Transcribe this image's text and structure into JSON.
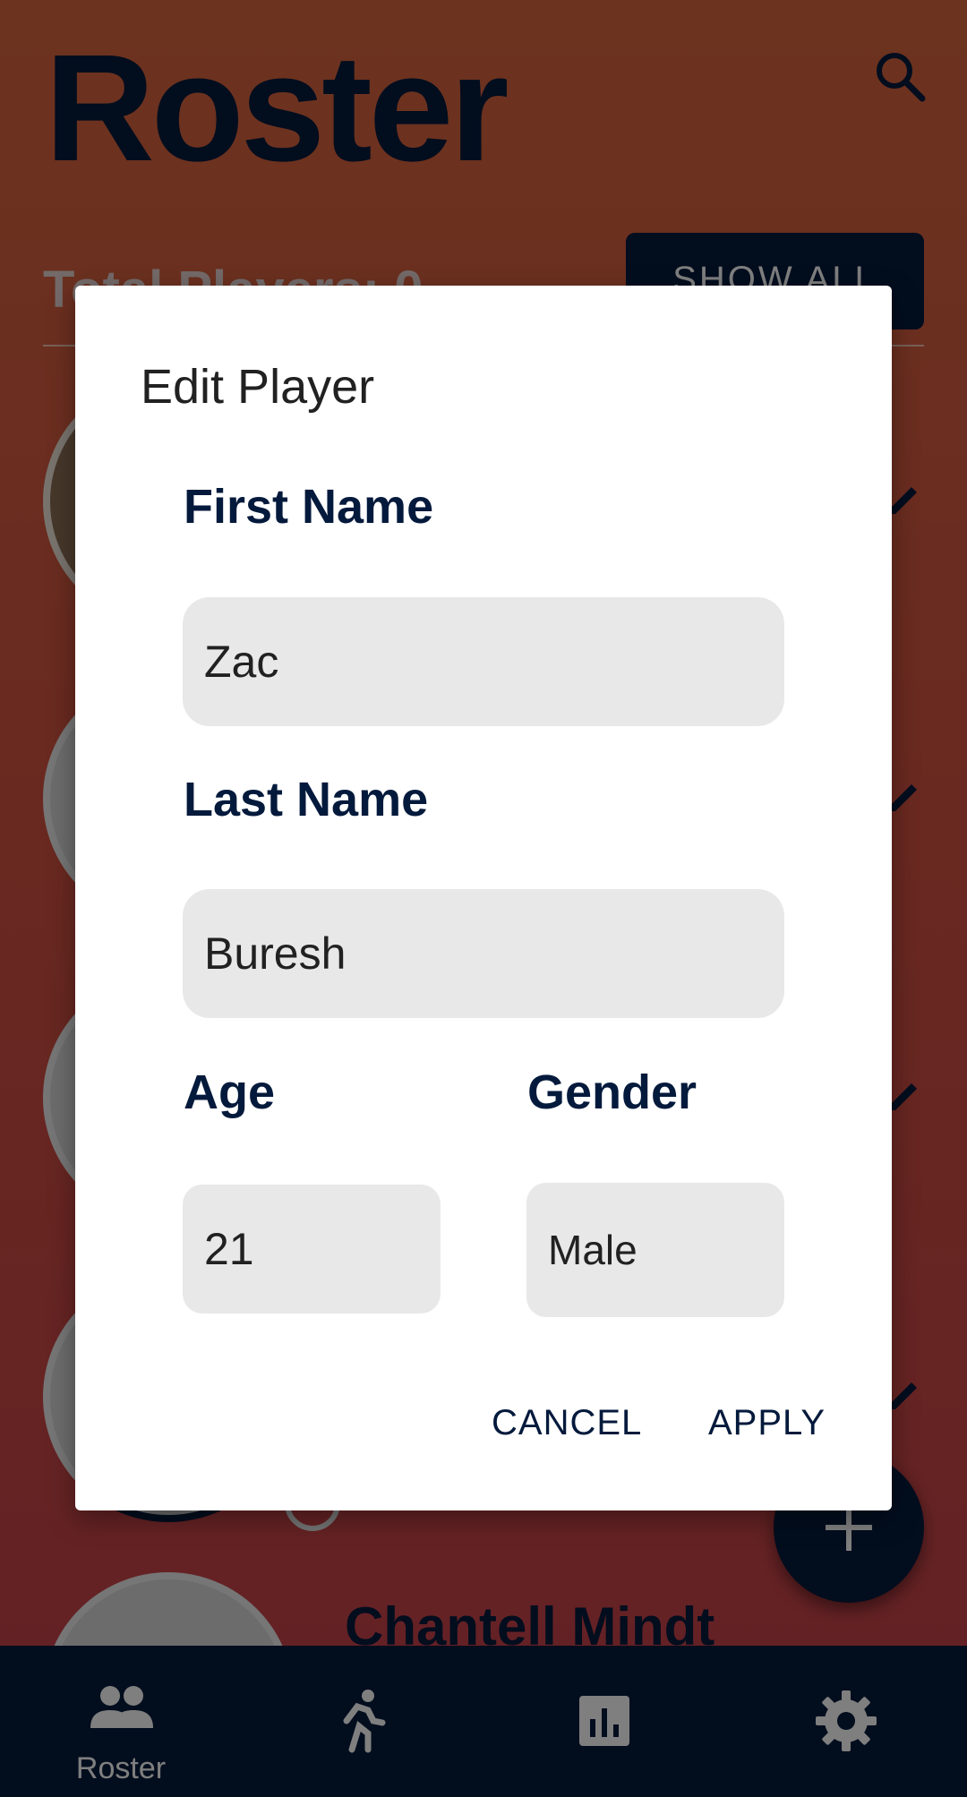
{
  "app": {
    "title": "Roster",
    "total_players_label": "Total Players:",
    "total_players_value": "0",
    "show_all_label": "SHOW ALL",
    "partially_visible_player_name": "Chantell Mindt"
  },
  "dialog": {
    "title": "Edit Player",
    "first_name_label": "First Name",
    "first_name_value": "Zac",
    "last_name_label": "Last Name",
    "last_name_value": "Buresh",
    "age_label": "Age",
    "age_value": "21",
    "gender_label": "Gender",
    "gender_value": "Male",
    "cancel_label": "CANCEL",
    "apply_label": "APPLY"
  },
  "bottom_nav": {
    "items": [
      {
        "label": "Roster",
        "icon": "people-icon",
        "active": true
      },
      {
        "label": "",
        "icon": "running-person-icon",
        "active": false
      },
      {
        "label": "",
        "icon": "bar-chart-icon",
        "active": false
      },
      {
        "label": "",
        "icon": "gear-icon",
        "active": false
      }
    ]
  },
  "colors": {
    "primary_navy": "#041a3c",
    "background_orange": "#d9673f",
    "field_grey": "#e8e8e8"
  }
}
